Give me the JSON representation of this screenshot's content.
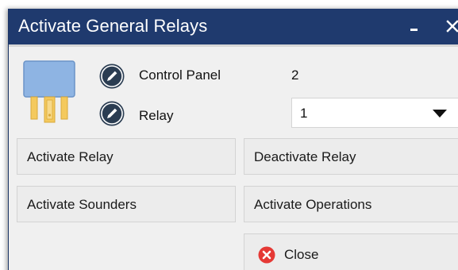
{
  "window": {
    "title": "Activate General Relays"
  },
  "form": {
    "control_panel_label": "Control Panel",
    "control_panel_value": "2",
    "relay_label": "Relay",
    "relay_selected": "1"
  },
  "buttons": {
    "activate_relay": "Activate Relay",
    "deactivate_relay": "Deactivate Relay",
    "activate_sounders": "Activate Sounders",
    "activate_operations": "Activate Operations",
    "close": "Close"
  },
  "icons": {
    "device": "relay-device-icon",
    "edit": "edit-pencil-icon",
    "close": "close-circle-icon",
    "dropdown": "chevron-down-icon",
    "minimize": "minimize-icon",
    "window_close": "close-icon"
  },
  "colors": {
    "title_bar": "#1f3a6e",
    "window_bg": "#f0f0f0",
    "button_bg": "#ececec",
    "device_body": "#8eb4e3",
    "device_pins": "#f4c95d",
    "edit_icon": "#2b3d52",
    "close_icon": "#e53935"
  }
}
